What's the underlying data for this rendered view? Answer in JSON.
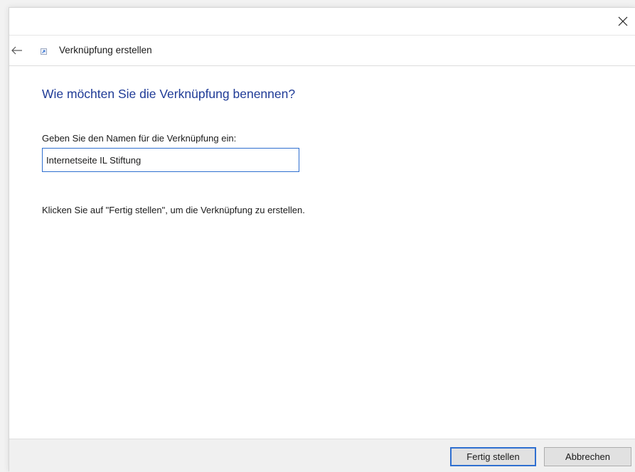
{
  "window": {
    "close_icon": "close-icon"
  },
  "nav": {
    "back_icon": "back-arrow-icon",
    "shortcut_icon": "shortcut-icon",
    "title": "Verknüpfung erstellen"
  },
  "main": {
    "heading": "Wie möchten Sie die Verknüpfung benennen?",
    "name_label": "Geben Sie den Namen für die Verknüpfung ein:",
    "name_value": "Internetseite IL Stiftung",
    "instruction": "Klicken Sie auf \"Fertig stellen\", um die Verknüpfung zu erstellen."
  },
  "footer": {
    "finish_label": "Fertig stellen",
    "cancel_label": "Abbrechen"
  },
  "colors": {
    "heading": "#1e3a96",
    "accent": "#2f6fd0",
    "footer_bg": "#f0f0f0",
    "button_bg": "#e1e1e1"
  }
}
